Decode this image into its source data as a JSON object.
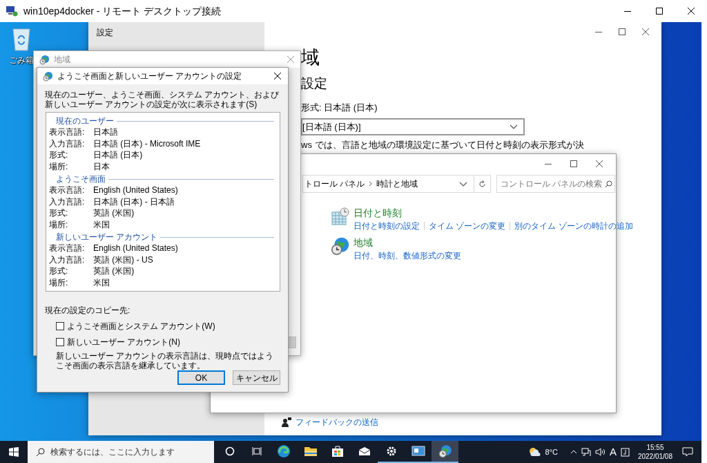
{
  "rdp_window": {
    "title": "win10ep4docker - リモート デスクトップ接続"
  },
  "desktop_icons": [
    {
      "kind": "recycle",
      "label": "ごみ箱"
    }
  ],
  "settings_window": {
    "app_title": "設定",
    "heading": "域",
    "subheading": "設定",
    "format_label": "形式: 日本語 (日本)",
    "format_select": "[日本語 (日本)]",
    "description": "ws では、言語と地域の環境設定に基づいて日付と時刻の表示形式が決",
    "feedback_link": "フィードバックの送信"
  },
  "region_dialog": {
    "title": "地域"
  },
  "welcome_dialog": {
    "title": "ようこそ画面と新しいユーザー アカウントの設定",
    "intro": "現在のユーザー、ようこそ画面、システム アカウント、および新しいユーザー アカウントの設定が次に表示されます(S)",
    "sections": [
      {
        "title": "現在のユーザー",
        "rows": [
          {
            "label": "表示言語:",
            "value": "日本語"
          },
          {
            "label": "入力言語:",
            "value": "日本語 (日本) - Microsoft IME"
          },
          {
            "label": "形式:",
            "value": "日本語 (日本)"
          },
          {
            "label": "場所:",
            "value": "日本"
          }
        ]
      },
      {
        "title": "ようこそ画面",
        "rows": [
          {
            "label": "表示言語:",
            "value": "English (United States)"
          },
          {
            "label": "入力言語:",
            "value": "日本語 (日本) - 日本語"
          },
          {
            "label": "形式:",
            "value": "英語 (米国)"
          },
          {
            "label": "場所:",
            "value": "米国"
          }
        ]
      },
      {
        "title": "新しいユーザー アカウント",
        "rows": [
          {
            "label": "表示言語:",
            "value": "English (United States)"
          },
          {
            "label": "入力言語:",
            "value": "英語 (米国) - US"
          },
          {
            "label": "形式:",
            "value": "英語 (米国)"
          },
          {
            "label": "場所:",
            "value": "米国"
          }
        ]
      }
    ],
    "copy_label": "現在の設定のコピー先:",
    "checkboxes": [
      {
        "label": "ようこそ画面とシステム アカウント(W)",
        "checked": false
      },
      {
        "label": "新しいユーザー アカウント(N)",
        "checked": false
      }
    ],
    "note": "新しいユーザー アカウントの表示言語は、現時点ではようこそ画面の表示言語を継承しています。",
    "buttons": [
      {
        "label": "OK",
        "default": true
      },
      {
        "label": "キャンセル",
        "default": false
      }
    ]
  },
  "control_panel": {
    "breadcrumb": [
      "トロール パネル",
      "時計と地域"
    ],
    "search": {
      "placeholder": "コントロール パネルの検索"
    },
    "categories": [
      {
        "kind": "clock",
        "title": "日付と時刻",
        "links": [
          "日付と時刻の設定",
          "タイム ゾーンの変更",
          "別のタイム ゾーンの時計の追加"
        ]
      },
      {
        "kind": "globe",
        "title": "地域",
        "links": [
          "日付、時刻、数値形式の変更"
        ]
      }
    ]
  },
  "taskbar": {
    "search": {
      "placeholder": "検索するには、ここに入力します"
    },
    "apps": [
      {
        "kind": "cortana",
        "running": false,
        "active": false
      },
      {
        "kind": "taskview",
        "running": false,
        "active": false
      },
      {
        "kind": "edge",
        "running": false,
        "active": false
      },
      {
        "kind": "explorer",
        "running": false,
        "active": false
      },
      {
        "kind": "store",
        "running": false,
        "active": false
      },
      {
        "kind": "mail",
        "running": false,
        "active": false
      },
      {
        "kind": "settings",
        "running": true,
        "active": false
      },
      {
        "kind": "rdp",
        "running": true,
        "active": false
      },
      {
        "kind": "region",
        "running": true,
        "active": true
      }
    ],
    "temperature": "8°C",
    "ime": "A",
    "time": "15:55",
    "date": "2022/01/08"
  }
}
